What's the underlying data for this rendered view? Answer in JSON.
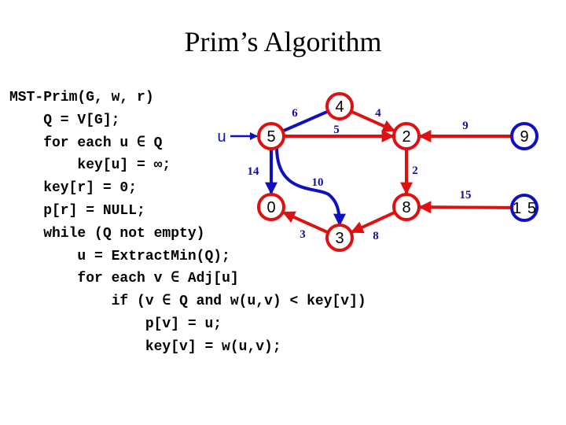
{
  "title": "Prim’s Algorithm",
  "code_lines": [
    "MST-Prim(G, w, r)",
    "    Q = V[G];",
    "    for each u ∈ Q",
    "        key[u] = ∞;",
    "    key[r] = 0;",
    "    p[r] = NULL;",
    "    while (Q not empty)",
    "        u = ExtractMin(Q);",
    "        for each v ∈ Adj[u]",
    "            if (v ∈ Q and w(u,v) < key[v])",
    "                p[v] = u;",
    "                key[v] = w(u,v);"
  ],
  "graph": {
    "pointer_label": "u",
    "colors": {
      "in_tree": "#e01010",
      "in_queue": "#1010c0",
      "weight_text": "#1010a0"
    },
    "nodes": [
      {
        "id": "n4",
        "key": "4",
        "state": "in_tree"
      },
      {
        "id": "n5",
        "key": "5",
        "state": "in_tree"
      },
      {
        "id": "n2",
        "key": "2",
        "state": "in_tree"
      },
      {
        "id": "n0",
        "key": "0",
        "state": "in_tree"
      },
      {
        "id": "n8",
        "key": "8",
        "state": "in_tree"
      },
      {
        "id": "n3",
        "key": "3",
        "state": "in_tree"
      },
      {
        "id": "n9",
        "key": "9",
        "state": "in_queue"
      },
      {
        "id": "n15",
        "key": "15",
        "state": "in_queue"
      }
    ],
    "edges": [
      {
        "from": "n5",
        "to": "n4",
        "weight": "6",
        "color": "blue",
        "directed": false
      },
      {
        "from": "n4",
        "to": "n2",
        "weight": "4",
        "color": "red",
        "directed": true
      },
      {
        "from": "n5",
        "to": "n2",
        "weight": "5",
        "color": "red",
        "directed": true
      },
      {
        "from": "n5",
        "to": "n0",
        "weight": "14",
        "color": "blue",
        "directed": true
      },
      {
        "from": "n5",
        "to": "n3",
        "weight": "10",
        "color": "blue",
        "directed": true
      },
      {
        "from": "n2",
        "to": "n8",
        "weight": "2",
        "color": "red",
        "directed": true
      },
      {
        "from": "n3",
        "to": "n0",
        "weight": "3",
        "color": "red",
        "directed": true
      },
      {
        "from": "n8",
        "to": "n3",
        "weight": "8",
        "color": "red",
        "directed": true
      },
      {
        "from": "n9",
        "to": "n2",
        "weight": "9",
        "color": "red",
        "directed": true
      },
      {
        "from": "n15",
        "to": "n8",
        "weight": "15",
        "color": "red",
        "directed": true
      }
    ]
  }
}
